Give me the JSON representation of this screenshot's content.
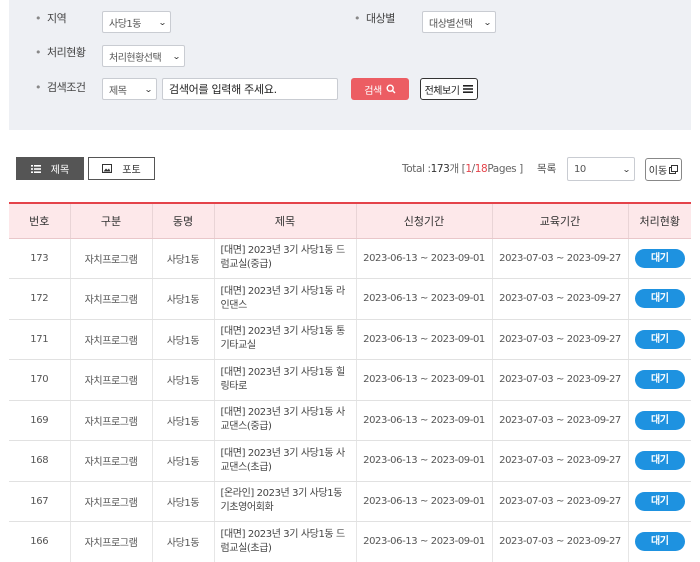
{
  "filters": {
    "region": {
      "label": "지역",
      "value": "사당1동"
    },
    "target": {
      "label": "대상별",
      "value": "대상별선택"
    },
    "status": {
      "label": "처리현황",
      "value": "처리현황선택"
    },
    "search": {
      "label": "검색조건",
      "field": "제목",
      "placeholder": "검색어를 입력해 주세요.",
      "search_label": "검색",
      "view_all_label": "전체보기"
    }
  },
  "toolbar": {
    "tab_list": "제목",
    "tab_photo": "포토",
    "total_prefix": "Total : ",
    "total_count": "173",
    "total_unit": " 개 [ ",
    "current_page": "1",
    "page_sep": " / ",
    "total_pages": "18",
    "pages_suffix": " Pages ]",
    "per_page_label": "목록",
    "per_page_value": "10",
    "move_label": "이동"
  },
  "table": {
    "columns": [
      "번호",
      "구분",
      "동명",
      "제목",
      "신청기간",
      "교육기간",
      "처리현황"
    ],
    "rows": [
      {
        "no": "173",
        "category": "자치프로그램",
        "dong": "사당1동",
        "title": "[대면] 2023년 3기 사당1동 드럼교실(중급)",
        "apply": "2023-06-13 ~ 2023-09-01",
        "edu": "2023-07-03 ~ 2023-09-27",
        "status": "대기"
      },
      {
        "no": "172",
        "category": "자치프로그램",
        "dong": "사당1동",
        "title": "[대면] 2023년 3기 사당1동 라인댄스",
        "apply": "2023-06-13 ~ 2023-09-01",
        "edu": "2023-07-03 ~ 2023-09-27",
        "status": "대기"
      },
      {
        "no": "171",
        "category": "자치프로그램",
        "dong": "사당1동",
        "title": "[대면] 2023년 3기 사당1동 통기타교실",
        "apply": "2023-06-13 ~ 2023-09-01",
        "edu": "2023-07-03 ~ 2023-09-27",
        "status": "대기"
      },
      {
        "no": "170",
        "category": "자치프로그램",
        "dong": "사당1동",
        "title": "[대면] 2023년 3기 사당1동 힐링타로",
        "apply": "2023-06-13 ~ 2023-09-01",
        "edu": "2023-07-03 ~ 2023-09-27",
        "status": "대기"
      },
      {
        "no": "169",
        "category": "자치프로그램",
        "dong": "사당1동",
        "title": "[대면] 2023년 3기 사당1동 사교댄스(중급)",
        "apply": "2023-06-13 ~ 2023-09-01",
        "edu": "2023-07-03 ~ 2023-09-27",
        "status": "대기"
      },
      {
        "no": "168",
        "category": "자치프로그램",
        "dong": "사당1동",
        "title": "[대면] 2023년 3기 사당1동 사교댄스(초급)",
        "apply": "2023-06-13 ~ 2023-09-01",
        "edu": "2023-07-03 ~ 2023-09-27",
        "status": "대기"
      },
      {
        "no": "167",
        "category": "자치프로그램",
        "dong": "사당1동",
        "title": "[온라인] 2023년 3기 사당1동 기초영어회화",
        "apply": "2023-06-13 ~ 2023-09-01",
        "edu": "2023-07-03 ~ 2023-09-27",
        "status": "대기"
      },
      {
        "no": "166",
        "category": "자치프로그램",
        "dong": "사당1동",
        "title": "[대면] 2023년 3기 사당1동 드럼교실(초급)",
        "apply": "2023-06-13 ~ 2023-09-01",
        "edu": "2023-07-03 ~ 2023-09-27",
        "status": "대기"
      }
    ]
  },
  "colors": {
    "accent_red": "#e4434a",
    "search_button": "#ec5d63",
    "status_blue": "#1e92e0",
    "header_pink": "#fde8ea",
    "panel_bg": "#eef0f4"
  }
}
